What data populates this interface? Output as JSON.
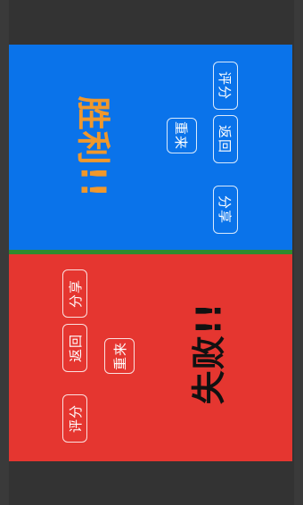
{
  "top_panel": {
    "title": "胜利!!",
    "restart_label": "重来",
    "back_label": "返回",
    "share_label": "分享",
    "rate_label": "评分",
    "color": "#0a73ea",
    "title_color": "#f0982c"
  },
  "bottom_panel": {
    "title": "失败!!",
    "restart_label": "重来",
    "back_label": "返回",
    "share_label": "分享",
    "rate_label": "评分",
    "color": "#e53630",
    "title_color": "#111111"
  },
  "divider_color": "#2e8b2e"
}
